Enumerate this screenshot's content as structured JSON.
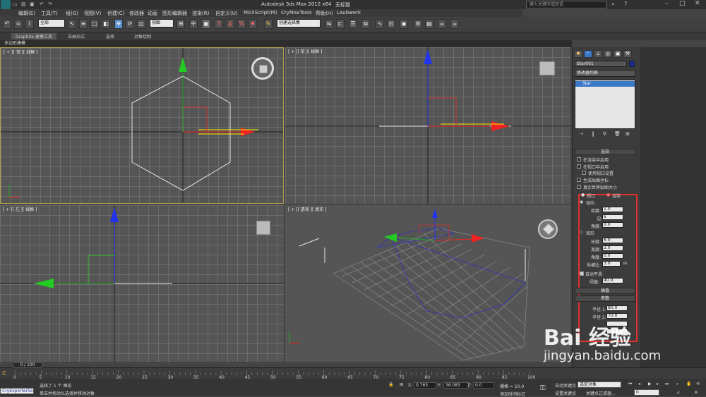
{
  "app": {
    "title_app": "Autodesk 3ds Max  2012 x64",
    "title_doc": "无标题",
    "search_placeholder": "键入关键字或短语"
  },
  "menu": [
    "编辑(E)",
    "工具(T)",
    "组(G)",
    "视图(V)",
    "创建(C)",
    "修改器",
    "动画",
    "图形编辑器",
    "渲染(R)",
    "自定义(U)",
    "MAXScript(M)",
    "CryMaxTools",
    "帮助(H)",
    "Laubwerk"
  ],
  "toolbar": {
    "selection_filter": "全部",
    "ref_coord": "视图",
    "named_selection": "创建选择集"
  },
  "ribbon": {
    "tabs": [
      "Graphite 建模工具",
      "自由形式",
      "选择",
      "对象绘制"
    ],
    "panel_label": "多边形建模"
  },
  "viewports": {
    "top": "[ + ][ 顶 ][ 线框 ]",
    "front": "[ + ][ 前 ][ 线框 ]",
    "left": "[ + ][ 左 ][ 线框 ]",
    "persp": "[ + ][ 透视 ][ 真实 ]"
  },
  "command_panel": {
    "object_name": "Star001",
    "modifier_list": "修改器列表",
    "stack_item": "Star",
    "rendering": {
      "header": "渲染",
      "in_renderer": "在渲染中启用",
      "in_viewport": "在视口中启用",
      "use_viewport_settings": "使用视口设置",
      "gen_mapping": "生成贴图坐标",
      "real_world": "真实世界贴图大小",
      "viewport_opt": "视口",
      "render_opt": "渲染",
      "radial": "径向",
      "thickness_label": "厚度:",
      "thickness_val": "1.0",
      "sides_label": "边:",
      "sides_val": "6",
      "angle_label": "角度:",
      "angle_val": "0.0",
      "rect": "矩形",
      "length_label": "长度:",
      "length_val": "6.0",
      "width_label": "宽度:",
      "width_val": "2.0",
      "angle2_label": "角度:",
      "angle2_val": "0.0",
      "aspect_label": "纵横比:",
      "aspect_val": "3.0",
      "auto_smooth": "自动平滑",
      "threshold_label": "阈值:",
      "threshold_val": "40.0"
    },
    "interp_header": "插值",
    "params_header": "参数",
    "radius1_label": "半径 1:",
    "radius1_val": "80.0",
    "radius2_label": "半径 2:",
    "radius2_val": "70.0"
  },
  "timeline": {
    "frame": "0 / 100",
    "ticks": [
      "0",
      "5",
      "10",
      "15",
      "20",
      "25",
      "30",
      "35",
      "40",
      "45",
      "50",
      "55",
      "60",
      "65",
      "70",
      "75",
      "80",
      "85",
      "90",
      "95",
      "100"
    ]
  },
  "status": {
    "script_box": "CryExporterSe",
    "selected": "选择了 1 个 图形",
    "hint": "单击并拖动以选择并移动对象",
    "x_label": "X:",
    "x_val": "0.765",
    "y_label": "Y:",
    "y_val": "36.083",
    "z_label": "Z:",
    "z_val": "0.0",
    "grid": "栅格 = 10.0",
    "add_tag": "添加时间标记",
    "auto_key": "自动关键点",
    "selected_obj": "选定对象",
    "set_key": "设置关键点",
    "key_filters": "关键点过滤器...",
    "frame_field": "0"
  },
  "watermark": {
    "brand": "Bai 经验",
    "url": "jingyan.baidu.com"
  }
}
